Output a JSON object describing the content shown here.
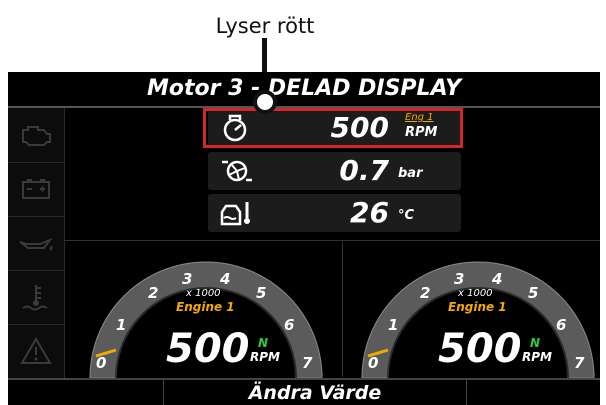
{
  "callout": {
    "label": "Lyser rött"
  },
  "header": {
    "title": "Motor 3 - DELAD DISPLAY"
  },
  "sidebar": {
    "icons": [
      "engine-warning-icon",
      "battery-icon",
      "oil-pressure-icon",
      "coolant-temp-icon",
      "warning-triangle-icon"
    ]
  },
  "readings": [
    {
      "icon": "engine-rpm-icon",
      "value": "500",
      "unit_top": "Eng 1",
      "unit": "RPM",
      "highlighted": true,
      "highlight_color": "#d4262b"
    },
    {
      "icon": "turbo-boost-icon",
      "value": "0.7",
      "unit": "bar"
    },
    {
      "icon": "oil-temp-icon",
      "value": "26",
      "unit": "°C"
    }
  ],
  "gauges": [
    {
      "ticks": [
        "0",
        "1",
        "2",
        "3",
        "4",
        "5",
        "6",
        "7"
      ],
      "multiplier": "x 1000",
      "engine": "Engine 1",
      "value": "500",
      "gear": "N",
      "unit": "RPM",
      "needle_fraction": 0.071
    },
    {
      "ticks": [
        "0",
        "1",
        "2",
        "3",
        "4",
        "5",
        "6",
        "7"
      ],
      "multiplier": "x 1000",
      "engine": "Engine 1",
      "value": "500",
      "gear": "N",
      "unit": "RPM",
      "needle_fraction": 0.071
    }
  ],
  "footer": {
    "center_button": "Ändra Värde"
  },
  "colors": {
    "accent_orange": "#f2a900",
    "neutral_green": "#2ecc40",
    "highlight_red": "#d4262b"
  }
}
